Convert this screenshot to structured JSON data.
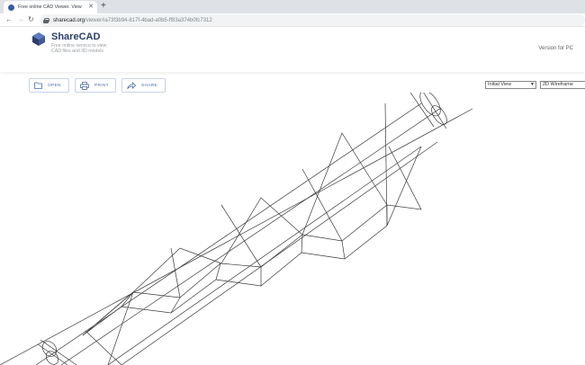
{
  "browser": {
    "tab_title": "Free online CAD Viewer. View A...",
    "url_host": "sharecad.org",
    "url_path": "/viewer#a73f3b94-817f-4bad-a0b5-ff83a374b0fc7312"
  },
  "site": {
    "brand": "ShareCAD",
    "tagline": "Free online service to view CAD files and 3D models",
    "version_link": "Version for PC"
  },
  "viewer_toolbar": {
    "open_label": "OPEN",
    "print_label": "PRINT",
    "share_label": "SHARE",
    "view_select": "Initial View",
    "mode_select": "2D Wireframe"
  },
  "colors": {
    "brand": "#2c3e69",
    "accent": "#4a6ea9"
  }
}
